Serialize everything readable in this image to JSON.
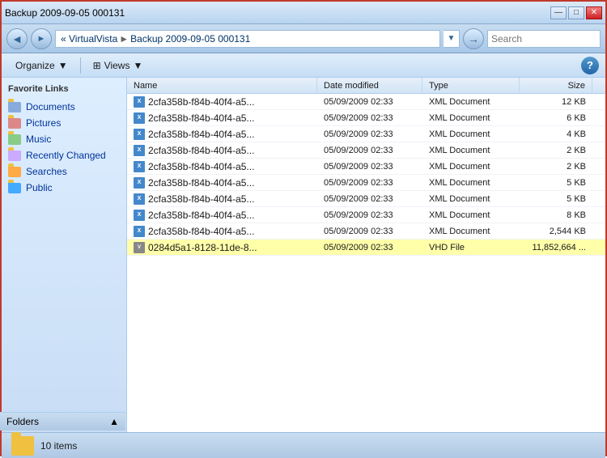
{
  "titleBar": {
    "title": "Backup 2009-09-05 000131",
    "controls": {
      "minimize": "—",
      "maximize": "□",
      "close": "✕"
    }
  },
  "addressBar": {
    "back": "◄",
    "forward": "►",
    "breadcrumb": {
      "root": "« VirtualVista",
      "separator": "►",
      "path": "Backup 2009-09-05 000131"
    },
    "search": {
      "placeholder": "Search"
    }
  },
  "toolbar": {
    "organize": "Organize",
    "views": "Views",
    "help": "?"
  },
  "sidebar": {
    "section": "Favorite Links",
    "items": [
      {
        "id": "documents",
        "label": "Documents",
        "icon": "docs"
      },
      {
        "id": "pictures",
        "label": "Pictures",
        "icon": "pics"
      },
      {
        "id": "music",
        "label": "Music",
        "icon": "music"
      },
      {
        "id": "recently-changed",
        "label": "Recently Changed",
        "icon": "recent"
      },
      {
        "id": "searches",
        "label": "Searches",
        "icon": "searches"
      },
      {
        "id": "public",
        "label": "Public",
        "icon": "public"
      }
    ],
    "folders": "Folders"
  },
  "fileList": {
    "headers": {
      "name": "Name",
      "dateModified": "Date modified",
      "type": "Type",
      "size": "Size"
    },
    "files": [
      {
        "name": "2cfa358b-f84b-40f4-a5...",
        "date": "05/09/2009 02:33",
        "type": "XML Document",
        "size": "12 KB",
        "selected": false,
        "iconType": "xml"
      },
      {
        "name": "2cfa358b-f84b-40f4-a5...",
        "date": "05/09/2009 02:33",
        "type": "XML Document",
        "size": "6 KB",
        "selected": false,
        "iconType": "xml"
      },
      {
        "name": "2cfa358b-f84b-40f4-a5...",
        "date": "05/09/2009 02:33",
        "type": "XML Document",
        "size": "4 KB",
        "selected": false,
        "iconType": "xml"
      },
      {
        "name": "2cfa358b-f84b-40f4-a5...",
        "date": "05/09/2009 02:33",
        "type": "XML Document",
        "size": "2 KB",
        "selected": false,
        "iconType": "xml"
      },
      {
        "name": "2cfa358b-f84b-40f4-a5...",
        "date": "05/09/2009 02:33",
        "type": "XML Document",
        "size": "2 KB",
        "selected": false,
        "iconType": "xml"
      },
      {
        "name": "2cfa358b-f84b-40f4-a5...",
        "date": "05/09/2009 02:33",
        "type": "XML Document",
        "size": "5 KB",
        "selected": false,
        "iconType": "xml"
      },
      {
        "name": "2cfa358b-f84b-40f4-a5...",
        "date": "05/09/2009 02:33",
        "type": "XML Document",
        "size": "5 KB",
        "selected": false,
        "iconType": "xml"
      },
      {
        "name": "2cfa358b-f84b-40f4-a5...",
        "date": "05/09/2009 02:33",
        "type": "XML Document",
        "size": "8 KB",
        "selected": false,
        "iconType": "xml"
      },
      {
        "name": "2cfa358b-f84b-40f4-a5...",
        "date": "05/09/2009 02:33",
        "type": "XML Document",
        "size": "2,544 KB",
        "selected": false,
        "iconType": "xml"
      },
      {
        "name": "0284d5a1-8128-11de-8...",
        "date": "05/09/2009 02:33",
        "type": "VHD File",
        "size": "11,852,664 ...",
        "selected": true,
        "iconType": "vhd"
      }
    ]
  },
  "statusBar": {
    "count": "10 items"
  }
}
